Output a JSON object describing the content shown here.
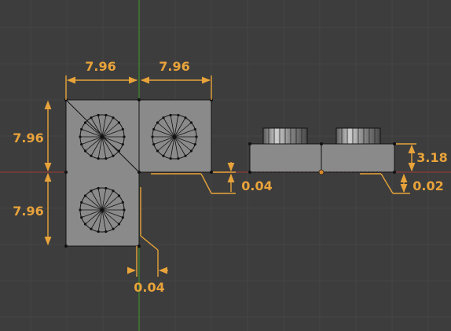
{
  "viewport": {
    "background": "#3d3d3d",
    "grid_color": "#454545",
    "x_axis_color": "#8b3b3b",
    "y_axis_color": "#3f8b2f",
    "dimension_color": "#e8a33a",
    "face_color": "#8a8a8a",
    "origin_color": "#d9892c"
  },
  "top_view": {
    "width_left": "7.96",
    "width_right": "7.96",
    "height_top": "7.96",
    "height_bottom": "7.96",
    "gap_horizontal": "0.04",
    "gap_vertical": "0.04"
  },
  "side_view": {
    "height": "3.18",
    "offset": "0.02"
  }
}
